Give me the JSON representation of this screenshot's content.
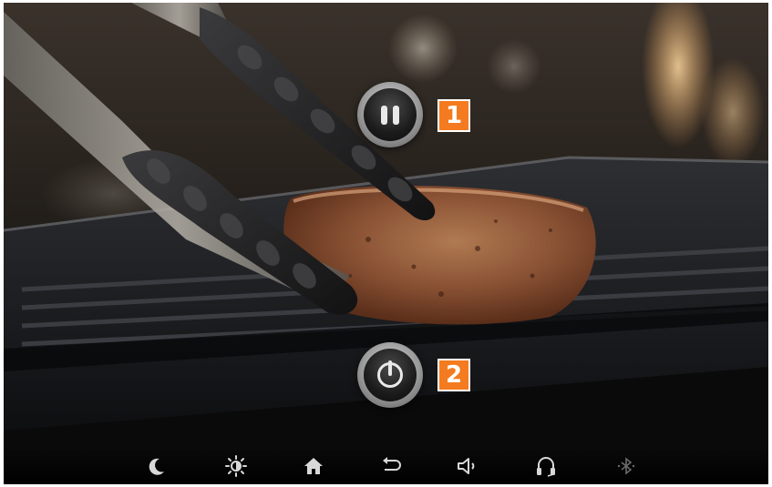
{
  "overlay": {
    "pause_badge": "1",
    "power_badge": "2",
    "pause_button": "pause-icon",
    "power_button": "power-icon",
    "badge_color": "#f47b1f"
  },
  "navbar": {
    "items": [
      {
        "icon": "moon-icon"
      },
      {
        "icon": "brightness-icon"
      },
      {
        "icon": "home-icon"
      },
      {
        "icon": "back-icon"
      },
      {
        "icon": "volume-icon"
      },
      {
        "icon": "headphones-icon"
      },
      {
        "icon": "bluetooth-icon"
      }
    ],
    "icon_color": "#d8d8d8",
    "disabled_color": "#6a6a6a"
  }
}
